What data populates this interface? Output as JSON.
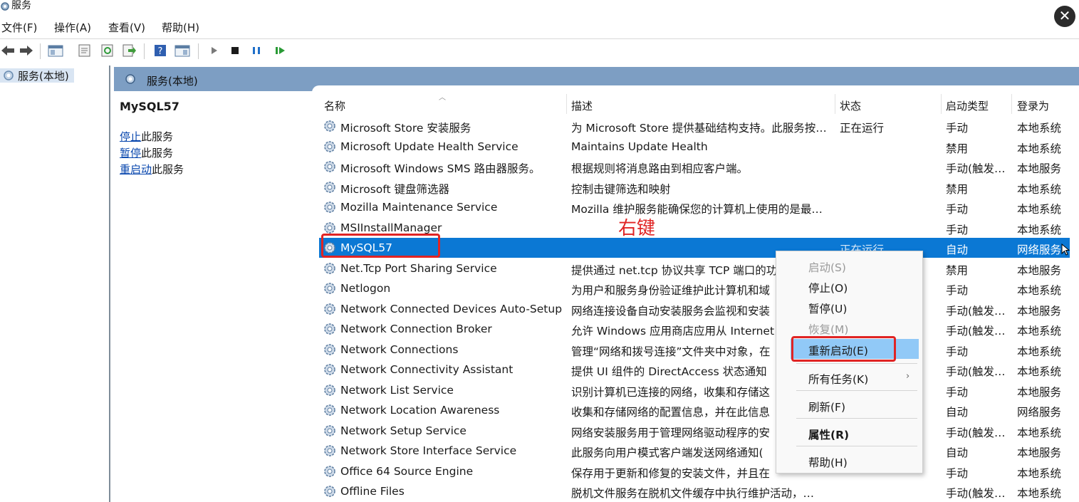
{
  "window": {
    "title": "服务",
    "close_glyph": "✕"
  },
  "menu": [
    "文件(F)",
    "操作(A)",
    "查看(V)",
    "帮助(H)"
  ],
  "toolbar": {
    "icons": [
      "back-icon",
      "forward-icon",
      "show-tree-icon",
      "properties-icon",
      "refresh-icon",
      "export-icon",
      "help-icon",
      "view-icon",
      "start-icon",
      "stop-icon",
      "pause-icon",
      "resume-icon"
    ]
  },
  "tree": {
    "item": "服务(本地)"
  },
  "main": {
    "header": "服务(本地)"
  },
  "detail": {
    "service_name": "MySQL57",
    "stop_link": "停止",
    "stop_suffix": "此服务",
    "pause_link": "暂停",
    "pause_suffix": "此服务",
    "restart_link": "重启动",
    "restart_suffix": "此服务"
  },
  "columns": [
    "名称",
    "描述",
    "状态",
    "启动类型",
    "登录为"
  ],
  "rows": [
    {
      "name": "Microsoft Store 安装服务",
      "desc": "为 Microsoft Store 提供基础结构支持。此服务按…",
      "status": "正在运行",
      "start": "手动",
      "logon": "本地系统"
    },
    {
      "name": "Microsoft Update Health Service",
      "desc": "Maintains Update Health",
      "status": "",
      "start": "禁用",
      "logon": "本地系统"
    },
    {
      "name": "Microsoft Windows SMS 路由器服务。",
      "desc": "根据规则将消息路由到相应客户端。",
      "status": "",
      "start": "手动(触发…",
      "logon": "本地服务"
    },
    {
      "name": "Microsoft 键盘筛选器",
      "desc": "控制击键筛选和映射",
      "status": "",
      "start": "禁用",
      "logon": "本地系统"
    },
    {
      "name": "Mozilla Maintenance Service",
      "desc": "Mozilla 维护服务能确保您的计算机上使用的是最…",
      "status": "",
      "start": "手动",
      "logon": "本地系统"
    },
    {
      "name": "MSIInstallManager",
      "desc": "",
      "status": "",
      "start": "手动",
      "logon": "本地系统"
    },
    {
      "name": "MySQL57",
      "desc": "",
      "status": "正在运行",
      "start": "自动",
      "logon": "网络服务"
    },
    {
      "name": "Net.Tcp Port Sharing Service",
      "desc": "提供通过 net.tcp 协议共享 TCP 端口的功",
      "status": "",
      "start": "禁用",
      "logon": "本地服务"
    },
    {
      "name": "Netlogon",
      "desc": "为用户和服务身份验证维护此计算机和域",
      "status": "",
      "start": "手动",
      "logon": "本地系统"
    },
    {
      "name": "Network Connected Devices Auto-Setup",
      "desc": "网络连接设备自动安装服务会监视和安装",
      "status": "",
      "start": "手动(触发…",
      "logon": "本地服务"
    },
    {
      "name": "Network Connection Broker",
      "desc": "允许 Windows 应用商店应用从 Internet",
      "status": "",
      "start": "手动(触发…",
      "logon": "本地系统"
    },
    {
      "name": "Network Connections",
      "desc": "管理“网络和拨号连接”文件夹中对象，在",
      "status": "",
      "start": "手动",
      "logon": "本地系统"
    },
    {
      "name": "Network Connectivity Assistant",
      "desc": "提供 UI 组件的 DirectAccess 状态通知",
      "status": "",
      "start": "手动(触发…",
      "logon": "本地系统"
    },
    {
      "name": "Network List Service",
      "desc": "识别计算机已连接的网络，收集和存储这",
      "status": "",
      "start": "手动",
      "logon": "本地服务"
    },
    {
      "name": "Network Location Awareness",
      "desc": "收集和存储网络的配置信息，并在此信息",
      "status": "",
      "start": "自动",
      "logon": "网络服务"
    },
    {
      "name": "Network Setup Service",
      "desc": "网络安装服务用于管理网络驱动程序的安",
      "status": "",
      "start": "手动(触发…",
      "logon": "本地系统"
    },
    {
      "name": "Network Store Interface Service",
      "desc": "此服务向用户模式客户端发送网络通知(",
      "status": "",
      "start": "自动",
      "logon": "本地服务"
    },
    {
      "name": "Office 64 Source Engine",
      "desc": "保存用于更新和修复的安装文件，并且在",
      "status": "",
      "start": "手动",
      "logon": "本地系统"
    },
    {
      "name": "Offline Files",
      "desc": "脱机文件服务在脱机文件缓存中执行维护活动，…",
      "status": "",
      "start": "手动(触发…",
      "logon": "本地系统"
    }
  ],
  "annotation": "右键",
  "context_menu": {
    "start": "启动(S)",
    "stop": "停止(O)",
    "pause": "暂停(U)",
    "resume": "恢复(M)",
    "restart": "重新启动(E)",
    "all_tasks": "所有任务(K)",
    "refresh": "刷新(F)",
    "properties": "属性(R)",
    "help": "帮助(H)",
    "submenu_arrow": "›"
  },
  "colors": {
    "selection": "#0b78d4",
    "menu_highlight": "#91c9f7",
    "annotation_red": "#e02424",
    "header_band": "#7d9ec3"
  }
}
